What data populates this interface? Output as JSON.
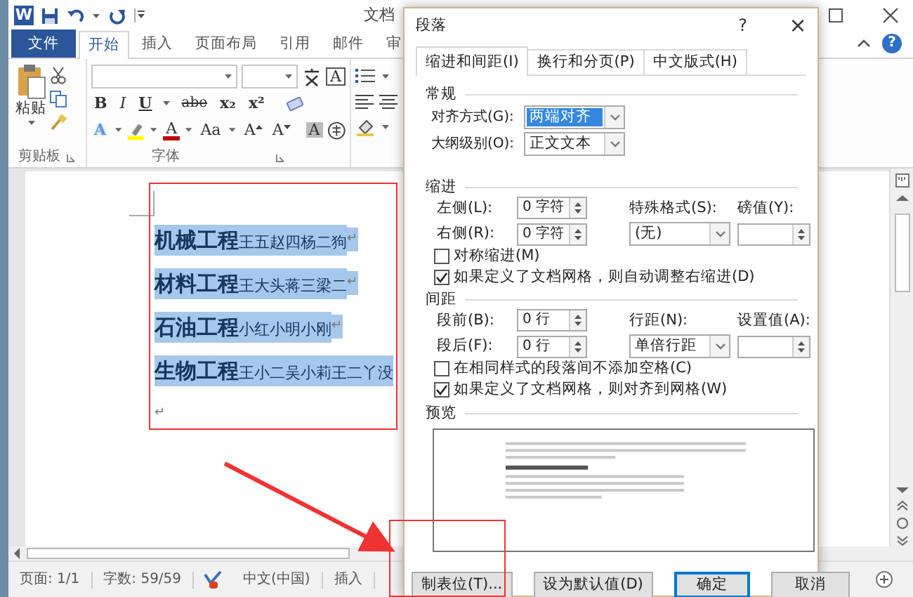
{
  "window": {
    "app_logo": "W",
    "title": "文档"
  },
  "ribbon_tabs": [
    {
      "label": "文件",
      "kind": "file",
      "selected": false
    },
    {
      "label": "开始",
      "kind": "tab",
      "selected": true
    },
    {
      "label": "插入",
      "kind": "tab",
      "selected": false
    },
    {
      "label": "页面布局",
      "kind": "tab",
      "selected": false
    },
    {
      "label": "引用",
      "kind": "tab",
      "selected": false
    },
    {
      "label": "邮件",
      "kind": "tab",
      "selected": false
    },
    {
      "label": "审",
      "kind": "tab",
      "selected": false
    }
  ],
  "ribbon_help": "?",
  "clipboard_group": {
    "paste": "粘贴",
    "label": "剪贴板"
  },
  "font_group": {
    "label": "字体",
    "border_char": "A",
    "format_buttons": [
      {
        "label": "B",
        "kind": "bold"
      },
      {
        "label": "I",
        "kind": "italic"
      },
      {
        "label": "U",
        "kind": "underline"
      },
      {
        "label": "abe",
        "kind": "strike"
      },
      {
        "label": "x₂",
        "kind": "sub"
      },
      {
        "label": "x²",
        "kind": "sup"
      }
    ],
    "style_buttons": [
      {
        "label": "A",
        "kind": "effect"
      },
      {
        "kind": "highlight"
      },
      {
        "label": "A",
        "kind": "color"
      },
      {
        "label": "Aa",
        "kind": "case"
      },
      {
        "label": "A",
        "kind": "grow"
      },
      {
        "label": "A",
        "kind": "shrink"
      },
      {
        "label": "A",
        "kind": "shade"
      },
      {
        "kind": "enclose"
      }
    ]
  },
  "document": {
    "paragraphs": [
      {
        "text": "**机械工程**王五赵四杨二狗",
        "mark": "↵",
        "selected": true
      },
      {
        "text": "**材料工程**王大头蒋三梁二",
        "mark": "↵",
        "selected": true
      },
      {
        "text": "**石油工程**小红小明小刚",
        "mark": "↵",
        "selected": true
      },
      {
        "text": "**生物工程**王小二吴小莉王二丫没",
        "selected": true
      },
      {
        "mark": "↵",
        "selected": false
      }
    ]
  },
  "status_bar": {
    "page": "页面: 1/1",
    "words": "字数: 59/59",
    "language": "中文(中国)",
    "mode": "插入"
  },
  "dialog": {
    "title": "段落",
    "help": "?",
    "close": "×",
    "tabs": [
      {
        "label": "缩进和间距(I)",
        "selected": true
      },
      {
        "label": "换行和分页(P)",
        "selected": false
      },
      {
        "label": "中文版式(H)",
        "selected": false
      }
    ],
    "general": {
      "heading": "常规",
      "fields": [
        {
          "label": "对齐方式(G):",
          "value": "两端对齐",
          "focused": true
        },
        {
          "label": "大纲级别(O):",
          "value": "正文文本",
          "focused": false
        }
      ]
    },
    "indentation": {
      "heading": "缩进",
      "left": {
        "label": "左侧(L):",
        "value": "0 字符"
      },
      "right": {
        "label": "右侧(R):",
        "value": "0 字符"
      },
      "special": {
        "label": "特殊格式(S):",
        "value": "(无)"
      },
      "by": {
        "label": "磅值(Y):"
      },
      "options": [
        {
          "label": "对称缩进(M)",
          "checked": false
        },
        {
          "label": "如果定义了文档网格，则自动调整右缩进(D)",
          "checked": true
        }
      ]
    },
    "spacing": {
      "heading": "间距",
      "left": {
        "label": "段前(B):",
        "value": "0 行"
      },
      "right": {
        "label": "段后(F):",
        "value": "0 行"
      },
      "special": {
        "label": "行距(N):",
        "value": "单倍行距"
      },
      "by": {
        "label": "设置值(A):"
      },
      "options": [
        {
          "label": "在相同样式的段落间不添加空格(C)",
          "checked": false
        },
        {
          "label": "如果定义了文档网格，则对齐到网格(W)",
          "checked": true
        }
      ]
    },
    "preview": {
      "heading": "预览"
    },
    "buttons": [
      {
        "label": "制表位(T)...",
        "default": false
      },
      {
        "label": "设为默认值(D)",
        "default": false
      },
      {
        "label": "确定",
        "default": true
      },
      {
        "label": "取消",
        "default": false
      }
    ]
  }
}
